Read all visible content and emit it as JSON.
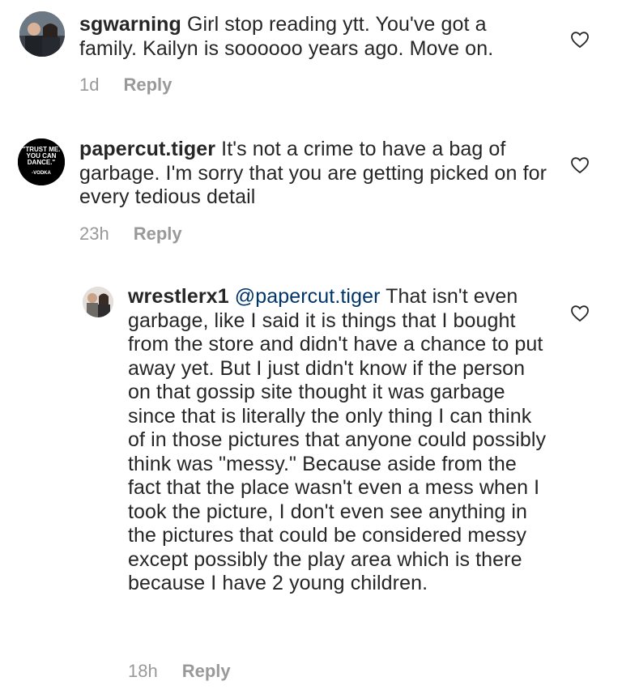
{
  "comments": [
    {
      "username": "sgwarning",
      "mention": "",
      "text": "Girl stop reading ytt. You've got a family. Kailyn is soooooo years ago. Move on.",
      "time": "1d",
      "reply_label": "Reply",
      "avatar_icon": "profile-photo-icon",
      "like_icon": "heart-outline-icon"
    },
    {
      "username": "papercut.tiger",
      "mention": "",
      "text": "It's not a crime to have a bag of garbage.  I'm sorry that you are getting picked on for every tedious detail",
      "time": "23h",
      "reply_label": "Reply",
      "avatar_icon": "profile-photo-icon",
      "avatar_text": [
        "\"TRUST ME.",
        "YOU CAN",
        "DANCE.\"",
        "-VODKA"
      ],
      "like_icon": "heart-outline-icon"
    },
    {
      "username": "wrestlerx1",
      "mention": "@papercut.tiger",
      "text": "That isn't even garbage, like I said it is things that I bought from the store and didn't have a chance to put away yet. But I just didn't know if the person on that gossip site thought it was garbage since that is literally the only thing I can think of in those pictures that anyone could possibly think was \"messy.\" Because aside from the fact that the place wasn't even a mess when I took the picture, I don't even see anything in the pictures that could be considered messy except possibly the play area which is there because I have 2 young children.",
      "time": "18h",
      "reply_label": "Reply",
      "avatar_icon": "profile-photo-icon",
      "like_icon": "heart-outline-icon"
    }
  ],
  "colors": {
    "text": "#262626",
    "mention": "#003569",
    "meta": "#999999",
    "background": "#ffffff"
  }
}
